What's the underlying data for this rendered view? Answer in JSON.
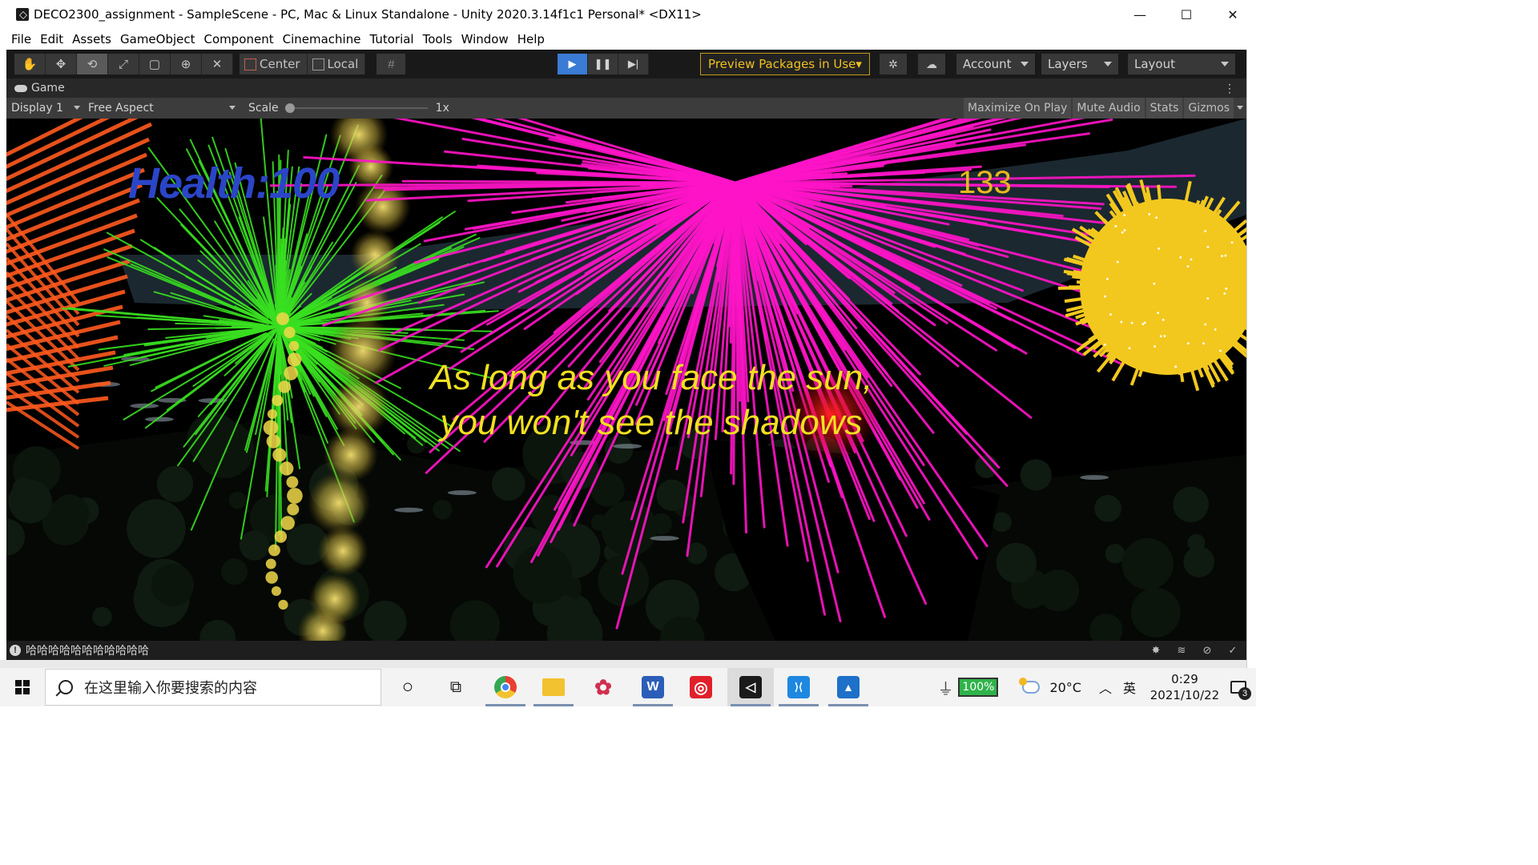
{
  "window": {
    "title": "DECO2300_assignment - SampleScene - PC, Mac & Linux Standalone - Unity 2020.3.14f1c1 Personal* <DX11>",
    "minimize_glyph": "—",
    "maximize_glyph": "☐",
    "close_glyph": "✕"
  },
  "menu": [
    "File",
    "Edit",
    "Assets",
    "GameObject",
    "Component",
    "Cinemachine",
    "Tutorial",
    "Tools",
    "Window",
    "Help"
  ],
  "toolbar": {
    "tools": [
      {
        "icon": "hand-tool-icon",
        "glyph": "✋"
      },
      {
        "icon": "move-tool-icon",
        "glyph": "✥"
      },
      {
        "icon": "rotate-tool-icon",
        "glyph": "⟲"
      },
      {
        "icon": "scale-tool-icon",
        "glyph": "⤢"
      },
      {
        "icon": "rect-tool-icon",
        "glyph": "▢"
      },
      {
        "icon": "transform-tool-icon",
        "glyph": "⊕"
      },
      {
        "icon": "custom-tool-icon",
        "glyph": "✕"
      }
    ],
    "active_tool_index": 2,
    "pivot_mode": "Center",
    "pivot_rotation": "Local",
    "snap_glyph": "#",
    "play_glyph": "▶",
    "pause_glyph": "❚❚",
    "step_glyph": "▶|",
    "preview_packages": "Preview Packages in Use",
    "preview_caret": "▾",
    "collab_glyph": "✲",
    "cloud_glyph": "☁",
    "account": "Account",
    "layers": "Layers",
    "layout": "Layout",
    "preview_color": "#f0c020"
  },
  "game_tab": {
    "label": "Game",
    "kebab": "⋮",
    "display": "Display 1",
    "aspect": "Free Aspect",
    "scale_label": "Scale",
    "scale_value": "1x",
    "buttons": [
      "Maximize On Play",
      "Mute Audio",
      "Stats",
      "Gizmos"
    ]
  },
  "game": {
    "health": "Health:100",
    "score": "133",
    "quote_line1": "As long as you face the sun,",
    "quote_line2": "you won't see the shadows",
    "colors": {
      "health": "#2b45c8",
      "score": "#e8b820",
      "quote": "#f2e020",
      "firework_green": "#39e020",
      "firework_magenta": "#ff14c8",
      "firework_orange": "#ff5a1e",
      "firework_yellow": "#f2c81e",
      "firework_red": "#ff1010"
    }
  },
  "status": {
    "message": "哈哈哈哈哈哈哈哈哈哈哈",
    "icon_glyph": "!",
    "right_icons": [
      "bug-off-icon",
      "layers-off-icon",
      "lighting-off-icon",
      "check-circle-icon"
    ],
    "right_glyphs": [
      "✸",
      "≋",
      "⊘",
      "✓"
    ]
  },
  "taskbar": {
    "search_placeholder": "在这里输入你要搜索的内容",
    "cortana_glyph": "○",
    "taskview_glyph": "⧉",
    "apps": [
      {
        "name": "chrome-icon",
        "glyph": "",
        "color": "#e84030"
      },
      {
        "name": "file-explorer-icon",
        "glyph": "",
        "color": "#f2c230"
      },
      {
        "name": "pinned-app-icon",
        "glyph": "✿",
        "color": "#ffffff"
      },
      {
        "name": "word-icon",
        "glyph": "W",
        "color": "#2b5eb8"
      },
      {
        "name": "netease-music-icon",
        "glyph": "◎",
        "color": "#e0202a"
      },
      {
        "name": "unity-icon",
        "glyph": "◁",
        "color": "#1a1a1a"
      },
      {
        "name": "vscode-icon",
        "glyph": "⟩⟨",
        "color": "#1e88e0"
      },
      {
        "name": "photos-icon",
        "glyph": "▲",
        "color": "#1e70c8"
      }
    ],
    "battery": "100%",
    "temperature": "20°C",
    "tray_chevron": "︿",
    "ime": "英",
    "time": "0:29",
    "date": "2021/10/22",
    "notifications": "3"
  }
}
